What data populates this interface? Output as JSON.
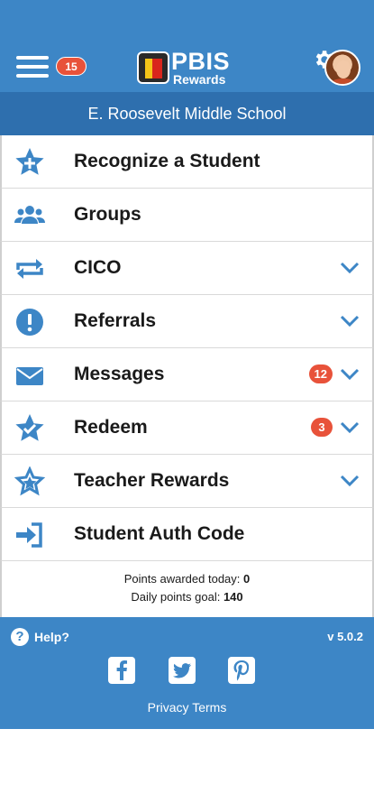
{
  "header": {
    "menu_badge": "15",
    "logo_title": "PBIS",
    "logo_subtitle": "Rewards",
    "school_name": "E. Roosevelt Middle School"
  },
  "menu": {
    "items": [
      {
        "label": "Recognize a Student",
        "icon": "star-plus-icon"
      },
      {
        "label": "Groups",
        "icon": "users-icon"
      },
      {
        "label": "CICO",
        "icon": "repeat-arrows-icon"
      },
      {
        "label": "Referrals",
        "icon": "exclamation-circle-icon"
      },
      {
        "label": "Messages",
        "icon": "envelope-icon",
        "badge": "12"
      },
      {
        "label": "Redeem",
        "icon": "star-check-icon",
        "badge": "3"
      },
      {
        "label": "Teacher Rewards",
        "icon": "star-outline-icon"
      },
      {
        "label": "Student Auth Code",
        "icon": "sign-in-icon"
      }
    ]
  },
  "points": {
    "awarded_label": "Points awarded today:",
    "awarded_value": "0",
    "goal_label": "Daily points goal:",
    "goal_value": "140"
  },
  "footer": {
    "help_label": "Help?",
    "version": "v 5.0.2",
    "privacy": "Privacy",
    "terms": "Terms"
  },
  "colors": {
    "primary": "#3d86c6",
    "school_bar": "#2e6fae",
    "badge": "#e8523a"
  }
}
